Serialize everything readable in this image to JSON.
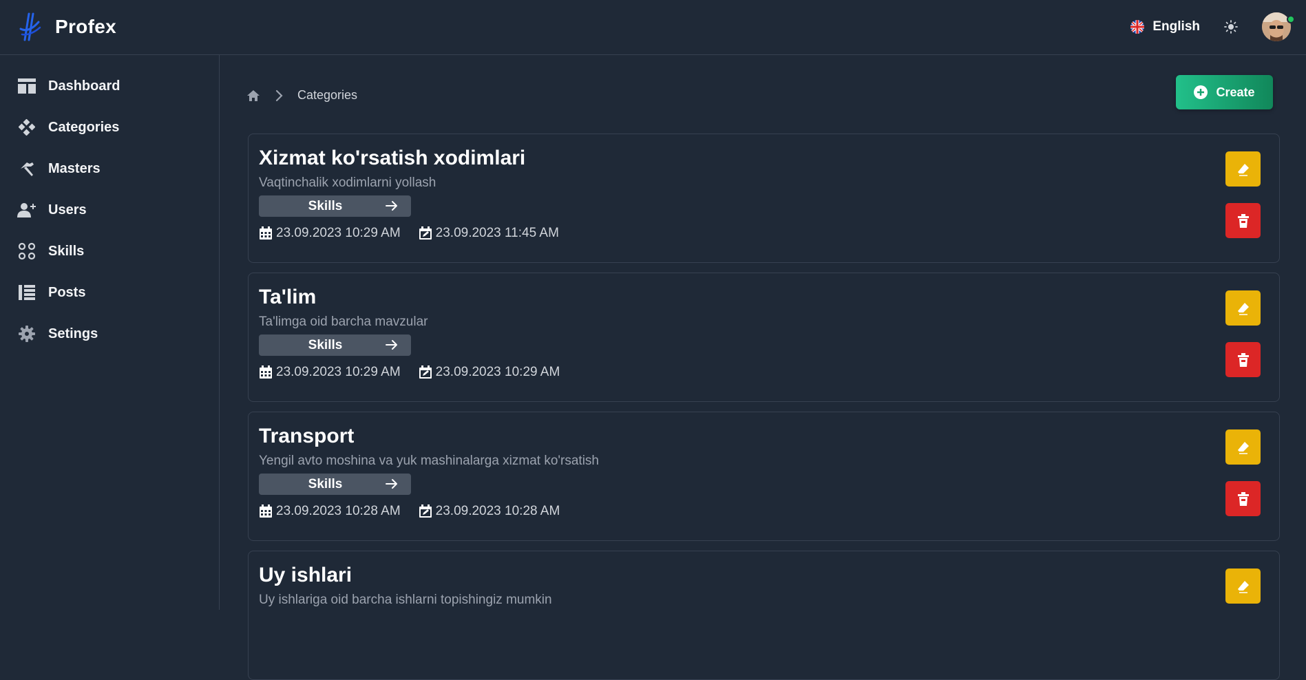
{
  "header": {
    "brand": "Profex",
    "language": "English"
  },
  "sidebar": {
    "items": [
      {
        "label": "Dashboard",
        "icon": "dashboard-icon"
      },
      {
        "label": "Categories",
        "icon": "categories-icon"
      },
      {
        "label": "Masters",
        "icon": "hammer-icon"
      },
      {
        "label": "Users",
        "icon": "user-plus-icon"
      },
      {
        "label": "Skills",
        "icon": "skills-icon"
      },
      {
        "label": "Posts",
        "icon": "list-icon"
      },
      {
        "label": "Setings",
        "icon": "gear-icon"
      }
    ]
  },
  "breadcrumb": {
    "current": "Categories"
  },
  "create_label": "Create",
  "skills_label": "Skills",
  "categories": [
    {
      "title": "Xizmat ko'rsatish xodimlari",
      "description": "Vaqtinchalik xodimlarni yollash",
      "created": "23.09.2023 10:29 AM",
      "updated": "23.09.2023 11:45 AM"
    },
    {
      "title": "Ta'lim",
      "description": "Ta'limga oid barcha mavzular",
      "created": "23.09.2023 10:29 AM",
      "updated": "23.09.2023 10:29 AM"
    },
    {
      "title": "Transport",
      "description": "Yengil avto moshina va yuk mashinalarga xizmat ko'rsatish",
      "created": "23.09.2023 10:28 AM",
      "updated": "23.09.2023 10:28 AM"
    },
    {
      "title": "Uy ishlari",
      "description": "Uy ishlariga oid barcha ishlarni topishingiz mumkin"
    }
  ],
  "colors": {
    "background": "#1f2937",
    "border": "#374151",
    "create": "#16a36f",
    "edit": "#eab308",
    "delete": "#dc2626",
    "brand_logo": "#2563eb",
    "online": "#22c55e"
  }
}
